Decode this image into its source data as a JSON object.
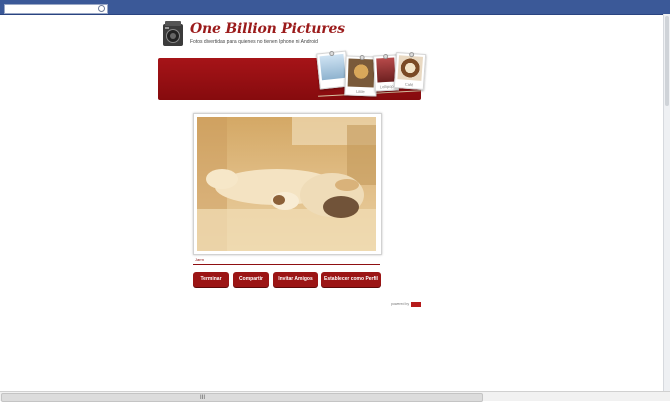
{
  "header": {
    "title": "One Billion Pictures",
    "subtitle": "Fotos divertidas para quienes no tienen Iphone ni Android"
  },
  "banner_photos": [
    {
      "caption": ""
    },
    {
      "caption": "Little"
    },
    {
      "caption": "Lollipop"
    },
    {
      "caption": "Café"
    }
  ],
  "photo": {
    "caption": "Jarrn"
  },
  "buttons": {
    "finish": "Terminar",
    "share": "Compartir",
    "invite": "Invitar Amigos",
    "profile": "Establecer como Perfil"
  },
  "footer": {
    "powered_by": "powered by"
  },
  "scrollbar": {
    "grip": "III"
  },
  "colors": {
    "brand_red": "#9b1515",
    "facebook_blue": "#3b5998",
    "sepia": "#d9b47a"
  },
  "icons": {
    "camera": "camera-logo-icon",
    "search": "search-icon"
  }
}
